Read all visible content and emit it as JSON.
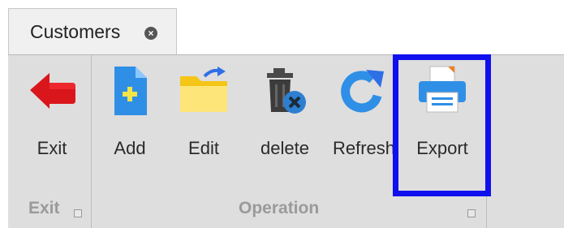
{
  "tab": {
    "label": "Customers",
    "close_icon": "close-circle-icon"
  },
  "ribbon": {
    "groups": [
      {
        "label": "Exit"
      },
      {
        "label": "Operation"
      }
    ],
    "buttons": [
      {
        "label": "Exit",
        "icon": "exit-arrow-icon"
      },
      {
        "label": "Add",
        "icon": "add-document-icon"
      },
      {
        "label": "Edit",
        "icon": "edit-folder-icon"
      },
      {
        "label": "delete",
        "icon": "delete-trash-icon"
      },
      {
        "label": "Refresh",
        "icon": "refresh-icon"
      },
      {
        "label": "Export",
        "icon": "printer-icon"
      }
    ]
  },
  "colors": {
    "highlight": "#1010ee",
    "exit": "#d9161c",
    "accent_blue": "#2f8fe6",
    "folder": "#f5c518"
  }
}
